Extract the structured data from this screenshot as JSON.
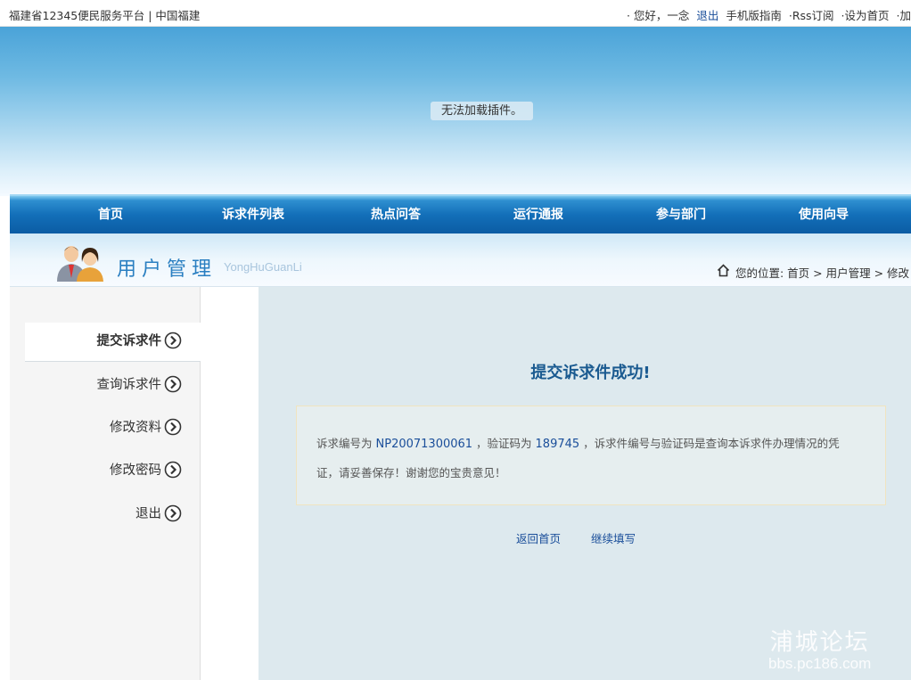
{
  "topbar": {
    "site_title": "福建省12345便民服务平台 | 中国福建",
    "greeting": "· 您好，一念",
    "logout": "退出",
    "mobile_guide": "手机版指南",
    "rss": "·Rss订阅",
    "set_home": "·设为首页",
    "more": "·加"
  },
  "banner": {
    "plugin_message": "无法加载插件。"
  },
  "nav": {
    "items": [
      "首页",
      "诉求件列表",
      "热点问答",
      "运行通报",
      "参与部门",
      "使用向导"
    ]
  },
  "page_head": {
    "title": "用户管理",
    "subtitle": "YongHuGuanLi",
    "breadcrumb": "您的位置: 首页 > 用户管理 > 修改"
  },
  "sidebar": {
    "items": [
      {
        "label": "提交诉求件"
      },
      {
        "label": "查询诉求件"
      },
      {
        "label": "修改资料"
      },
      {
        "label": "修改密码"
      },
      {
        "label": "退出"
      }
    ]
  },
  "main": {
    "success_title": "提交诉求件成功!",
    "notice": {
      "prefix": "诉求编号为",
      "case_no": "NP20071300061",
      "mid": "，验证码为",
      "code": "189745",
      "suffix": "，诉求件编号与验证码是查询本诉求件办理情况的凭",
      "line2": "证，请妥善保存！谢谢您的宝贵意见！"
    },
    "actions": {
      "back_home": "返回首页",
      "continue": "继续填写"
    }
  },
  "watermark": {
    "main": "浦城论坛",
    "sub": "bbs.pc186.com"
  },
  "colors": {
    "nav_blue": "#136fb9",
    "link_blue": "#1a4e9a",
    "title_blue": "#1a5a90"
  }
}
